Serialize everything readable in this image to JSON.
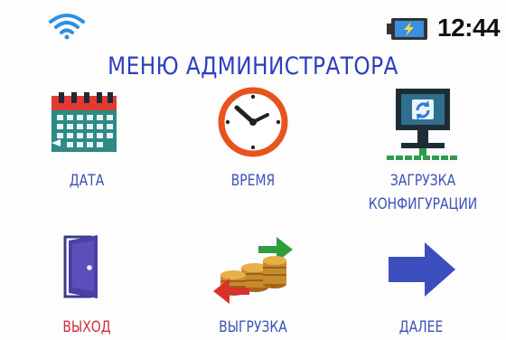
{
  "status": {
    "time": "12:44",
    "wifi_icon": "wifi-icon",
    "battery_icon": "battery-charging-icon"
  },
  "title": "МЕНЮ АДМИНИСТРАТОРА",
  "menu": {
    "date": {
      "label": "ДАТА",
      "icon": "calendar-icon"
    },
    "time": {
      "label": "ВРЕМЯ",
      "icon": "clock-icon"
    },
    "config": {
      "label_line1": "ЗАГРУЗКА",
      "label_line2": "КОНФИГУРАЦИИ",
      "icon": "computer-sync-icon"
    },
    "exit": {
      "label": "ВЫХОД",
      "icon": "door-icon"
    },
    "export": {
      "label": "ВЫГРУЗКА",
      "icon": "coins-transfer-icon"
    },
    "next": {
      "label": "ДАЛЕЕ",
      "icon": "arrow-right-icon"
    }
  },
  "colors": {
    "title": "#2c3fbf",
    "label": "#3c52b6",
    "exit_label": "#cf2e3e"
  }
}
